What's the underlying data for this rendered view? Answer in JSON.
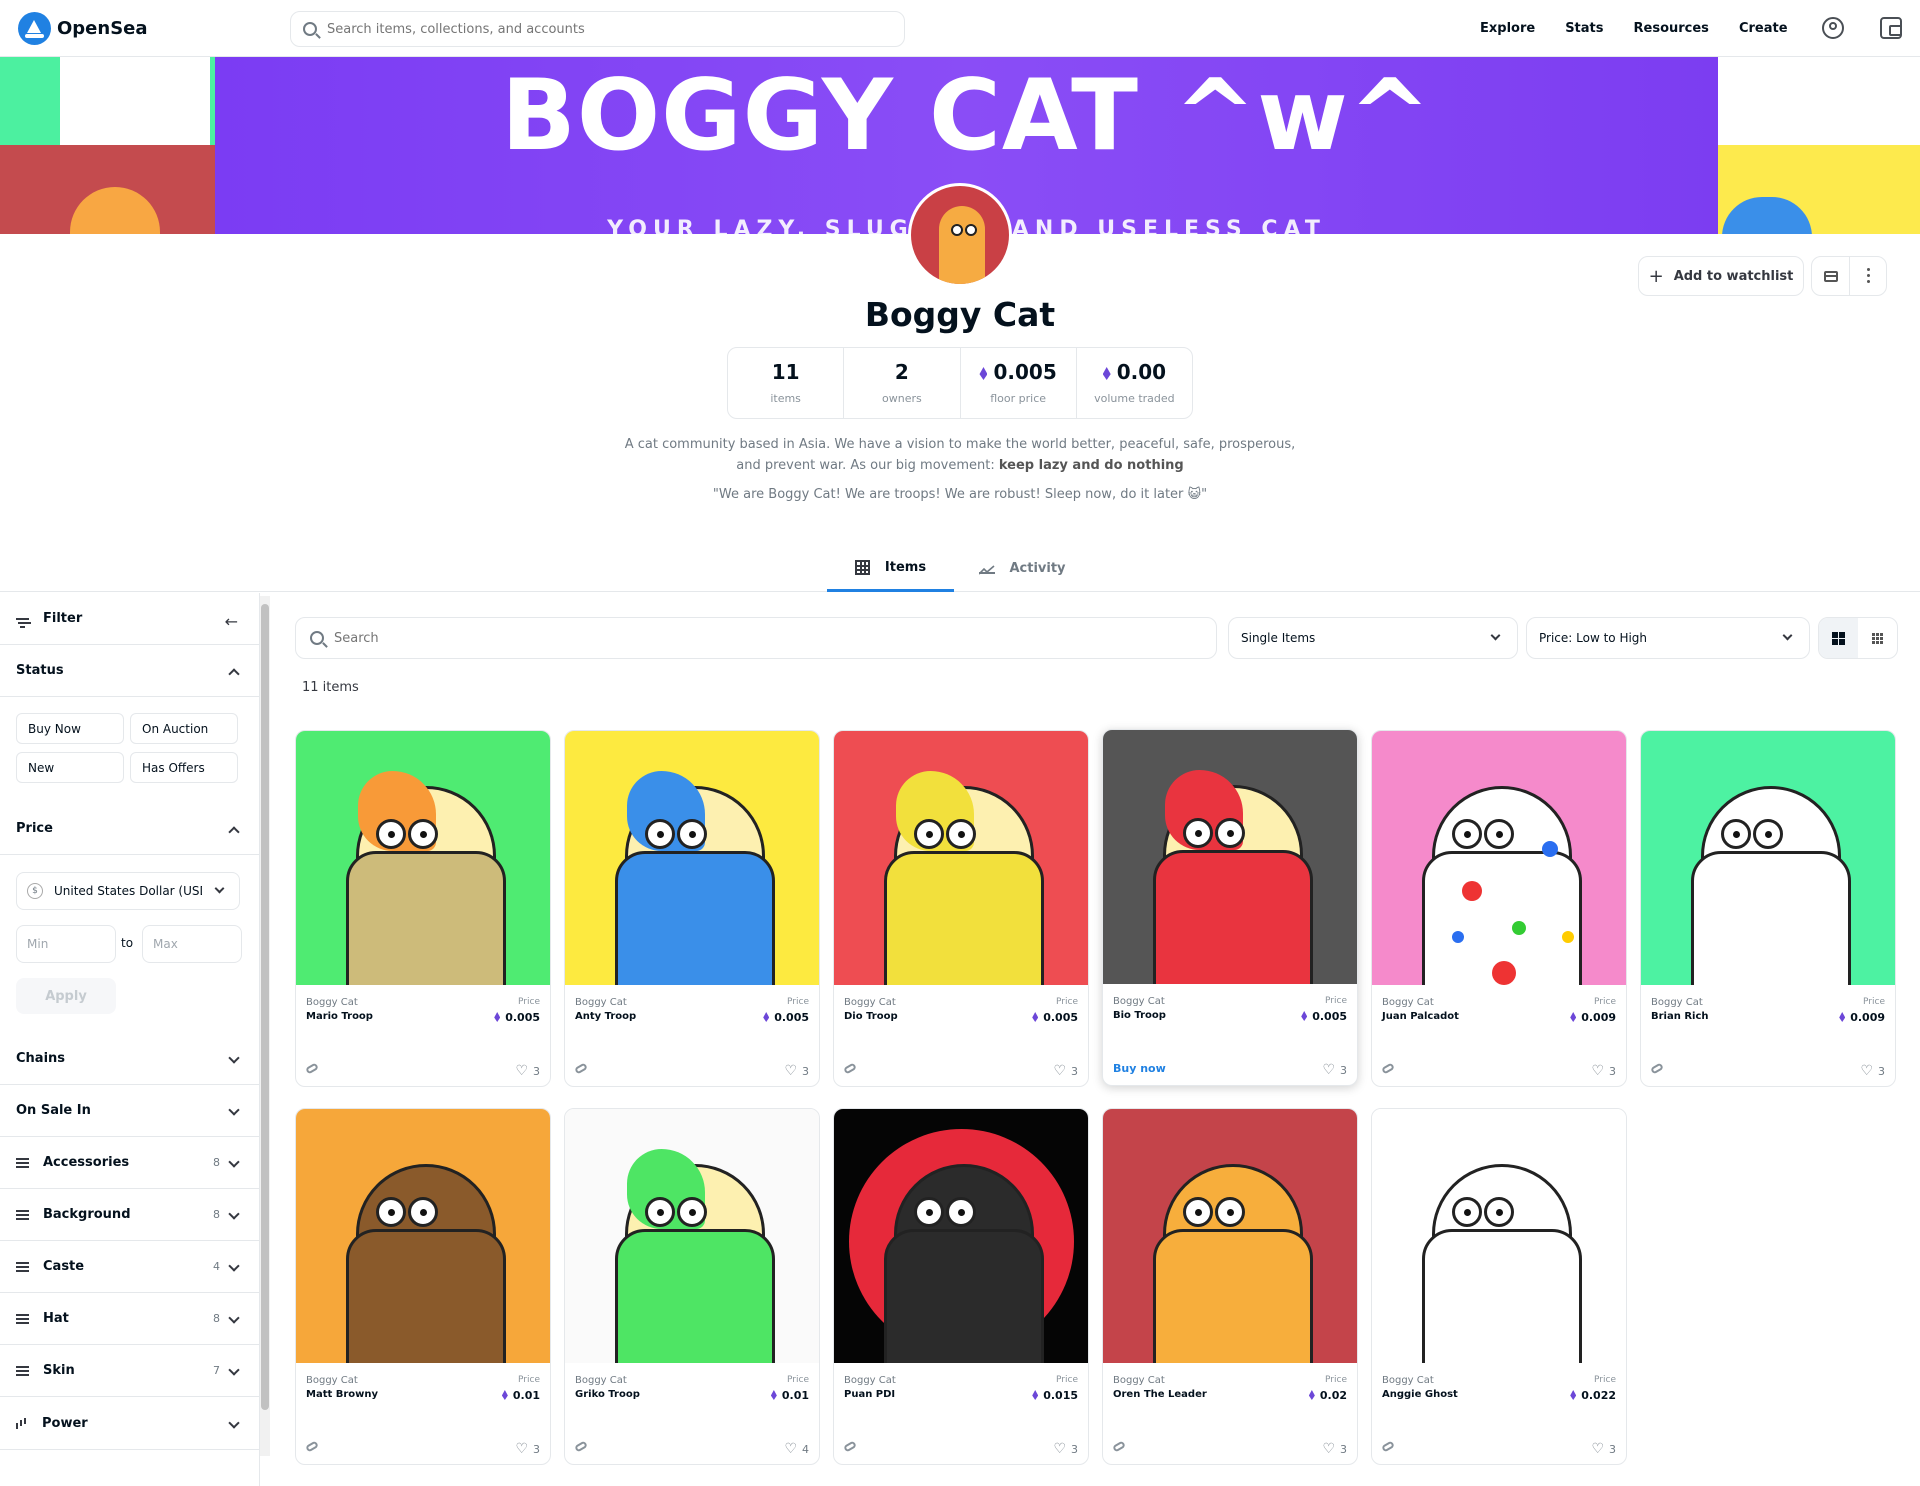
{
  "nav": {
    "brand": "OpenSea",
    "search_placeholder": "Search items, collections, and accounts",
    "links": [
      "Explore",
      "Stats",
      "Resources",
      "Create"
    ]
  },
  "banner": {
    "title": "BOGGY CAT ^w^",
    "subtitle": "YOUR LAZY, SLUGGISH AND USELESS CAT"
  },
  "collection": {
    "name": "Boggy Cat",
    "watchlist_label": "Add to watchlist",
    "stats": [
      {
        "value": "11",
        "label": "items"
      },
      {
        "value": "2",
        "label": "owners"
      },
      {
        "value": "0.005",
        "label": "floor price"
      },
      {
        "value": "0.00",
        "label": "volume traded"
      }
    ],
    "description_1": "A cat community based in Asia. We have a vision to make the world better, peaceful, safe, prosperous, and prevent war. As our big movement: ",
    "description_bold": "keep lazy and do nothing",
    "quote": "\"We are Boggy Cat! We are troops! We are robust! Sleep now, do it later 😺\""
  },
  "tabs": {
    "items": "Items",
    "activity": "Activity"
  },
  "filter": {
    "title": "Filter",
    "status_label": "Status",
    "status_buttons": [
      "Buy Now",
      "On Auction",
      "New",
      "Has Offers"
    ],
    "price_label": "Price",
    "currency": "United States Dollar (USD)",
    "min_placeholder": "Min",
    "to": "to",
    "max_placeholder": "Max",
    "apply": "Apply",
    "chains": "Chains",
    "on_sale_in": "On Sale In",
    "traits": [
      {
        "name": "Accessories",
        "count": "8"
      },
      {
        "name": "Background",
        "count": "8"
      },
      {
        "name": "Caste",
        "count": "4"
      },
      {
        "name": "Hat",
        "count": "8"
      },
      {
        "name": "Skin",
        "count": "7"
      }
    ],
    "power": "Power"
  },
  "toolbar": {
    "search_placeholder": "Search",
    "type_select": "Single Items",
    "sort_select": "Price: Low to High",
    "count": "11 items"
  },
  "card_meta": {
    "collection": "Boggy Cat",
    "price_label": "Price",
    "buy_now": "Buy now"
  },
  "items": [
    {
      "name": "Mario Troop",
      "price": "0.005",
      "likes": "3",
      "bg": "#4feb72",
      "shirt": "#cdbb7a",
      "hair": "#f89a38",
      "skin": "#fdf0b0"
    },
    {
      "name": "Anty Troop",
      "price": "0.005",
      "likes": "3",
      "bg": "#fdea40",
      "shirt": "#3a8fe9",
      "hair": "#3a8fe9",
      "skin": "#fdf0b0"
    },
    {
      "name": "Dio Troop",
      "price": "0.005",
      "likes": "3",
      "bg": "#ee4d52",
      "shirt": "#f2e03c",
      "hair": "#f2e03c",
      "skin": "#fdf0b0"
    },
    {
      "name": "Bio Troop",
      "price": "0.005",
      "likes": "3",
      "bg": "#555555",
      "shirt": "#e9343f",
      "hair": "#e9343f",
      "skin": "#fdf0b0"
    },
    {
      "name": "Juan Palcadot",
      "price": "0.009",
      "likes": "3",
      "bg": "#f58acb",
      "shirt": "#ffffff",
      "hair": "#ffffff",
      "skin": "#ffffff"
    },
    {
      "name": "Brian Rich",
      "price": "0.009",
      "likes": "3",
      "bg": "#4df2a2",
      "shirt": "#ffffff",
      "hair": "#ffffff",
      "skin": "#ffffff"
    },
    {
      "name": "Matt Browny",
      "price": "0.01",
      "likes": "3",
      "bg": "#f6a73a",
      "shirt": "#8a5a2b",
      "hair": "#8a5a2b",
      "skin": "#8a5a2b"
    },
    {
      "name": "Griko Troop",
      "price": "0.01",
      "likes": "4",
      "bg": "#fafafa",
      "shirt": "#4ee564",
      "hair": "#4ee564",
      "skin": "#fdf0b0"
    },
    {
      "name": "Puan PDI",
      "price": "0.015",
      "likes": "3",
      "bg": "#050505",
      "shirt": "#2b2b2b",
      "hair": "#2b2b2b",
      "skin": "#2b2b2b"
    },
    {
      "name": "Oren The Leader",
      "price": "0.02",
      "likes": "3",
      "bg": "#c4444a",
      "shirt": "#f7ae3c",
      "hair": "#f7ae3c",
      "skin": "#f7ae3c"
    },
    {
      "name": "Anggie Ghost",
      "price": "0.022",
      "likes": "3",
      "bg": "#ffffff",
      "shirt": "#ffffff",
      "hair": "#ffffff",
      "skin": "#ffffff"
    }
  ]
}
